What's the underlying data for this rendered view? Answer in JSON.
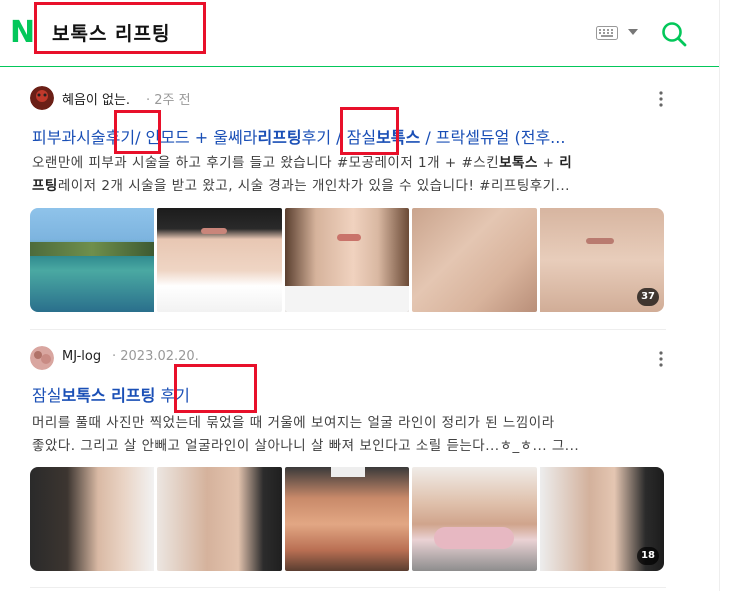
{
  "search": {
    "query": "보톡스 리프팅"
  },
  "colors": {
    "brand": "#03c75a",
    "link": "#1a4fb6",
    "highlight": "#e8102a"
  },
  "header": {
    "logo": "N"
  },
  "posts": [
    {
      "author": "혜음이 없는.",
      "date": "· 2주 전",
      "title_parts": [
        "피부과시술",
        "후기",
        "/ 인모드 + 울쎄라",
        "리프팅",
        "후기 / 잠실",
        "보톡스",
        " / 프락셀듀얼 (전후..."
      ],
      "snippet_line1": [
        "오랜만에 피부과 시술을 하고 후기를 들고 왔습니다 #모공레이저 1개 + #스킨",
        "보톡스",
        " + ",
        "리"
      ],
      "snippet_line2": [
        "프팅",
        "레이저 2개 시술을 받고 왔고, 시술 경과는 개인차가 있을 수 있습니다! #리프팅후기..."
      ],
      "image_count": "37"
    },
    {
      "author": "MJ-log",
      "date": "· 2023.02.20.",
      "title_parts": [
        "잠실",
        "보톡스 리프팅",
        " 후기"
      ],
      "snippet_line1": "머리를 풀때 사진만 찍었는데 묶었을 때 거울에 보여지는 얼굴 라인이 정리가 된 느낌이라",
      "snippet_line2": "좋았다. 그리고 살 안빼고 얼굴라인이 살아나니 살 빠져 보인다고 소릴 듣는다...ㅎ_ㅎ... 그...",
      "image_count": "18"
    }
  ]
}
